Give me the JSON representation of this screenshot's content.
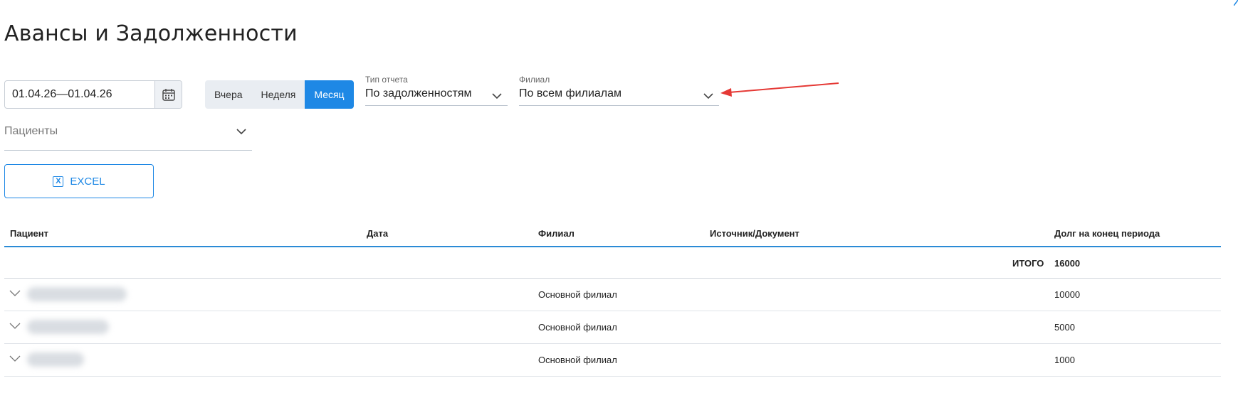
{
  "page": {
    "title": "Авансы и Задолженности"
  },
  "filters": {
    "date_range": "01.04.26—01.04.26",
    "periods": [
      {
        "label": "Вчера",
        "active": false
      },
      {
        "label": "Неделя",
        "active": false
      },
      {
        "label": "Месяц",
        "active": true
      }
    ],
    "report_type": {
      "label": "Тип отчета",
      "value": "По задолженностям"
    },
    "branch": {
      "label": "Филиал",
      "value": "По всем филиалам"
    },
    "patients": {
      "placeholder": "Пациенты"
    }
  },
  "actions": {
    "excel_label": "EXCEL",
    "excel_icon": "excel-icon"
  },
  "colors": {
    "accent": "#1e88e5",
    "arrow": "#e53935"
  },
  "table": {
    "columns": [
      "Пациент",
      "Дата",
      "Филиал",
      "Источник/Документ",
      "Долг на конец периода"
    ],
    "total": {
      "label": "ИТОГО",
      "value": "16000"
    },
    "rows": [
      {
        "branch": "Основной филиал",
        "debt": "10000"
      },
      {
        "branch": "Основной филиал",
        "debt": "5000"
      },
      {
        "branch": "Основной филиал",
        "debt": "1000"
      }
    ]
  }
}
